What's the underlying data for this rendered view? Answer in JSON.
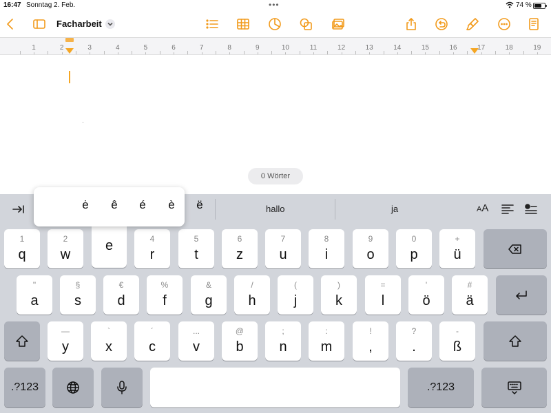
{
  "status_bar": {
    "time": "16:47",
    "date": "Sonntag 2. Feb.",
    "battery_percent": "74 %",
    "battery_level": 0.74
  },
  "toolbar": {
    "title": "Facharbeit",
    "accent_color": "#f29a1a"
  },
  "ruler": {
    "numbers": [
      "1",
      "2",
      "3",
      "4",
      "5",
      "6",
      "7",
      "8",
      "9",
      "10",
      "11",
      "12",
      "13",
      "14",
      "15",
      "16",
      "17",
      "18",
      "19"
    ]
  },
  "document": {
    "word_count": "0 Wörter"
  },
  "keyboard": {
    "suggestions": [
      "hallo",
      "ja"
    ],
    "format_label": "AA",
    "accent_popup": {
      "base": "e",
      "options": [
        "ė",
        "ê",
        "é",
        "è",
        "ë"
      ]
    },
    "rows": [
      [
        {
          "sec": "1",
          "pri": "q"
        },
        {
          "sec": "2",
          "pri": "w"
        },
        {
          "sec": "3",
          "pri": "e"
        },
        {
          "sec": "4",
          "pri": "r"
        },
        {
          "sec": "5",
          "pri": "t"
        },
        {
          "sec": "6",
          "pri": "z"
        },
        {
          "sec": "7",
          "pri": "u"
        },
        {
          "sec": "8",
          "pri": "i"
        },
        {
          "sec": "9",
          "pri": "o"
        },
        {
          "sec": "0",
          "pri": "p"
        },
        {
          "sec": "+",
          "pri": "ü"
        }
      ],
      [
        {
          "sec": "\"",
          "pri": "a"
        },
        {
          "sec": "§",
          "pri": "s"
        },
        {
          "sec": "€",
          "pri": "d"
        },
        {
          "sec": "%",
          "pri": "f"
        },
        {
          "sec": "&",
          "pri": "g"
        },
        {
          "sec": "/",
          "pri": "h"
        },
        {
          "sec": "(",
          "pri": "j"
        },
        {
          "sec": ")",
          "pri": "k"
        },
        {
          "sec": "=",
          "pri": "l"
        },
        {
          "sec": "'",
          "pri": "ö"
        },
        {
          "sec": "#",
          "pri": "ä"
        }
      ],
      [
        {
          "sec": "—",
          "pri": "y"
        },
        {
          "sec": "`",
          "pri": "x"
        },
        {
          "sec": "´",
          "pri": "c"
        },
        {
          "sec": "...",
          "pri": "v"
        },
        {
          "sec": "@",
          "pri": "b"
        },
        {
          "sec": ";",
          "pri": "n"
        },
        {
          "sec": ":",
          "pri": "m"
        },
        {
          "sec": "!",
          "pri": ","
        },
        {
          "sec": "?",
          "pri": "."
        },
        {
          "sec": "-",
          "pri": "ß"
        }
      ]
    ],
    "numbers_label": ".?123"
  }
}
